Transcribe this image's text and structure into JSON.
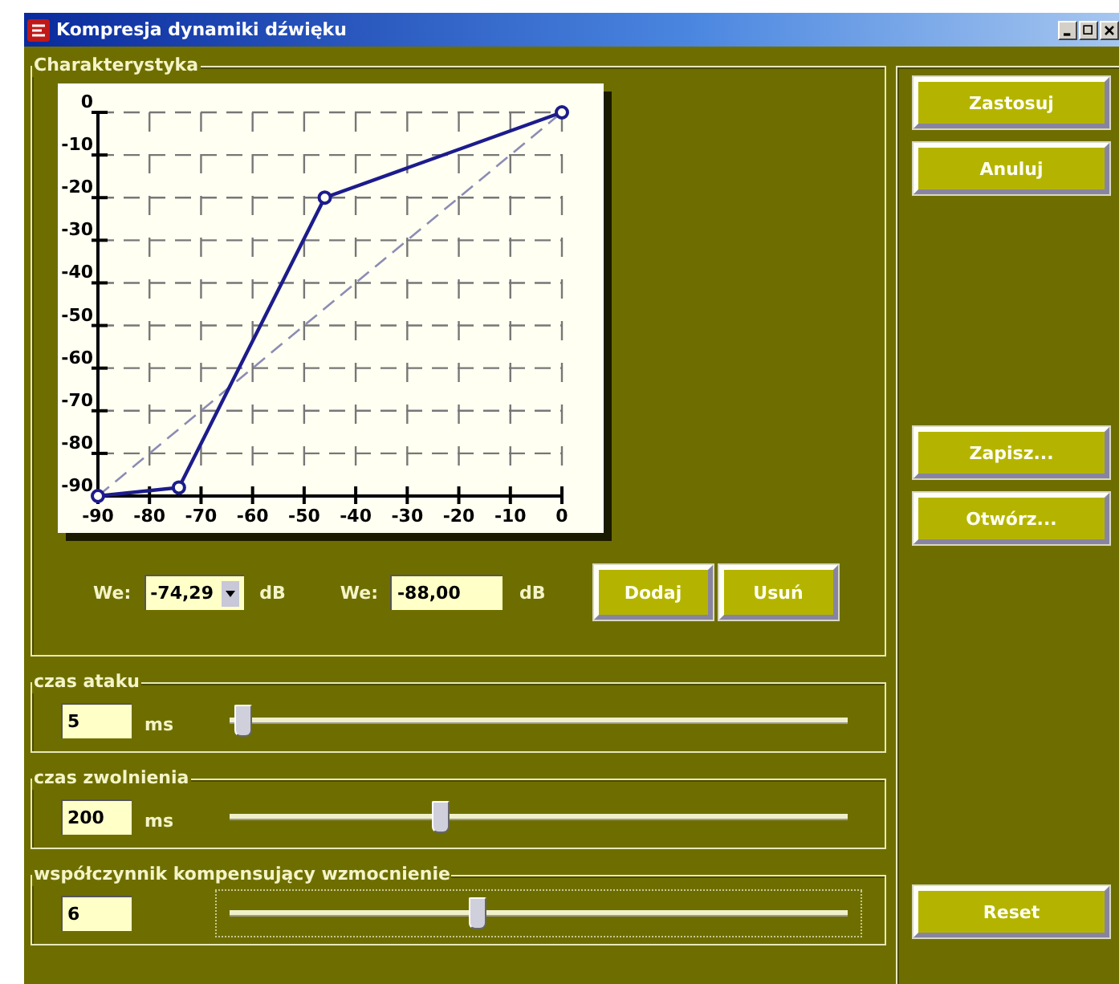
{
  "window": {
    "title": "Kompresja dynamiki dźwięku"
  },
  "characteristic": {
    "title": "Charakterystyka",
    "chart_data": {
      "type": "line",
      "x": [
        -90,
        -74.29,
        -46,
        0
      ],
      "series": [
        {
          "color": "#1c1c8c",
          "marker": "o",
          "values": [
            -90,
            -88,
            -20,
            0
          ]
        }
      ],
      "grid": true,
      "xlim": [
        -90,
        0
      ],
      "ylim": [
        -90,
        0
      ],
      "xticks": [
        -90,
        -80,
        -70,
        -60,
        -50,
        -40,
        -30,
        -20,
        -10,
        0
      ],
      "yticks": [
        0,
        -10,
        -20,
        -30,
        -40,
        -50,
        -60,
        -70,
        -80,
        -90
      ]
    },
    "inputs": [
      {
        "label": "We:",
        "value": "-74,29",
        "unit": "dB",
        "kind": "dropdown"
      },
      {
        "label": "We:",
        "value": "-88,00",
        "unit": "dB",
        "kind": "text"
      }
    ],
    "buttons": [
      "Dodaj",
      "Usuń"
    ]
  },
  "sliders": [
    {
      "title": "czas ataku",
      "value": "5",
      "unit": "ms",
      "level": 0.02,
      "focused": false
    },
    {
      "title": "czas zwolnienia",
      "value": "200",
      "unit": "ms",
      "level": 0.34,
      "focused": false
    },
    {
      "title": "współczynnik kompensujący wzmocnienie",
      "value": "6",
      "level": 0.4,
      "focused": true
    }
  ],
  "side_buttons": [
    [
      "Zastosuj",
      "Anuluj"
    ],
    [
      "Zapisz...",
      "Otwórz..."
    ],
    [
      "Reset"
    ]
  ]
}
